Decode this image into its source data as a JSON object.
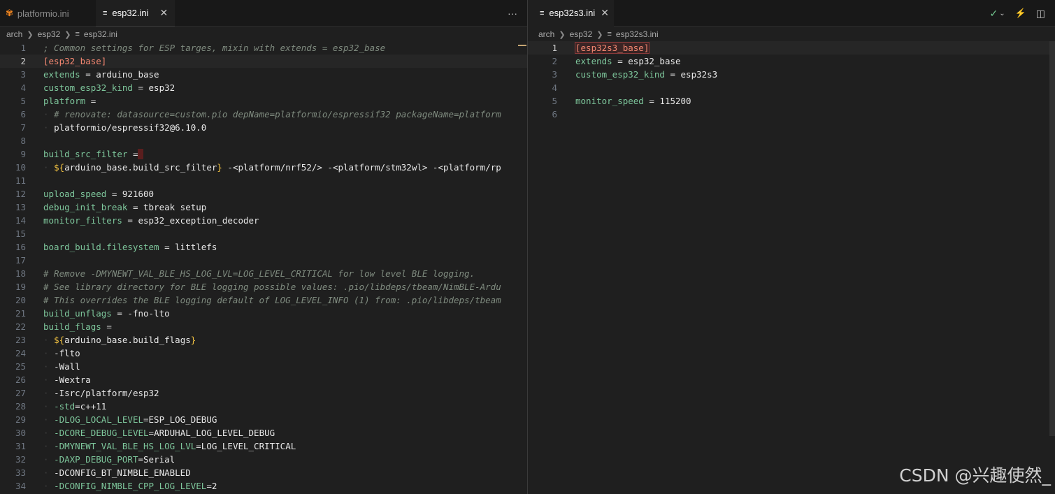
{
  "left_pane": {
    "tabs": [
      {
        "label": "platformio.ini",
        "active": false
      },
      {
        "label": "esp32.ini",
        "active": true
      }
    ],
    "more_actions": "···",
    "breadcrumb": [
      "arch",
      "esp32",
      "esp32.ini"
    ],
    "lines": [
      {
        "n": "1",
        "parts": [
          [
            "cm",
            "; Common settings for ESP targes, mixin with extends = esp32_base"
          ]
        ]
      },
      {
        "n": "2",
        "parts": [
          [
            "sec",
            "[esp32_base]"
          ]
        ],
        "current": true
      },
      {
        "n": "3",
        "parts": [
          [
            "kg",
            "extends"
          ],
          [
            "op",
            " = "
          ],
          [
            "v",
            "arduino_base"
          ]
        ]
      },
      {
        "n": "4",
        "parts": [
          [
            "kg",
            "custom_esp32_kind"
          ],
          [
            "op",
            " = "
          ],
          [
            "v",
            "esp32"
          ]
        ]
      },
      {
        "n": "5",
        "parts": [
          [
            "kg",
            "platform"
          ],
          [
            "op",
            " ="
          ]
        ]
      },
      {
        "n": "6",
        "parts": [
          [
            "dot",
            "  "
          ],
          [
            "cm",
            "# renovate: datasource=custom.pio depName=platformio/espressif32 packageName=platform"
          ]
        ]
      },
      {
        "n": "7",
        "parts": [
          [
            "dot",
            "  "
          ],
          [
            "v",
            "platformio/espressif32@6.10.0"
          ]
        ]
      },
      {
        "n": "8",
        "parts": []
      },
      {
        "n": "9",
        "parts": [
          [
            "kg",
            "build_src_filter"
          ],
          [
            "op",
            " ="
          ],
          [
            "sel",
            " "
          ]
        ]
      },
      {
        "n": "10",
        "parts": [
          [
            "dot",
            "  "
          ],
          [
            "br",
            "${"
          ],
          [
            "v",
            "arduino_base.build_src_filter"
          ],
          [
            "br",
            "}"
          ],
          [
            "v",
            " -<platform/nrf52/> -<platform/stm32wl> -<platform/rp"
          ]
        ]
      },
      {
        "n": "11",
        "parts": []
      },
      {
        "n": "12",
        "parts": [
          [
            "kg",
            "upload_speed"
          ],
          [
            "op",
            " = "
          ],
          [
            "v",
            "921600"
          ]
        ]
      },
      {
        "n": "13",
        "parts": [
          [
            "kg",
            "debug_init_break"
          ],
          [
            "op",
            " = "
          ],
          [
            "v",
            "tbreak setup"
          ]
        ]
      },
      {
        "n": "14",
        "parts": [
          [
            "kg",
            "monitor_filters"
          ],
          [
            "op",
            " = "
          ],
          [
            "v",
            "esp32_exception_decoder"
          ]
        ]
      },
      {
        "n": "15",
        "parts": []
      },
      {
        "n": "16",
        "parts": [
          [
            "kg",
            "board_build.filesystem"
          ],
          [
            "op",
            " = "
          ],
          [
            "v",
            "littlefs"
          ]
        ]
      },
      {
        "n": "17",
        "parts": []
      },
      {
        "n": "18",
        "parts": [
          [
            "cm",
            "# Remove -DMYNEWT_VAL_BLE_HS_LOG_LVL=LOG_LEVEL_CRITICAL for low level BLE logging."
          ]
        ]
      },
      {
        "n": "19",
        "parts": [
          [
            "cm",
            "# See library directory for BLE logging possible values: .pio/libdeps/tbeam/NimBLE-Ardu"
          ]
        ]
      },
      {
        "n": "20",
        "parts": [
          [
            "cm",
            "# This overrides the BLE logging default of LOG_LEVEL_INFO (1) from: .pio/libdeps/tbeam"
          ]
        ]
      },
      {
        "n": "21",
        "parts": [
          [
            "kg",
            "build_unflags"
          ],
          [
            "op",
            " = "
          ],
          [
            "v",
            "-fno-lto"
          ]
        ]
      },
      {
        "n": "22",
        "parts": [
          [
            "kg",
            "build_flags"
          ],
          [
            "op",
            " ="
          ]
        ]
      },
      {
        "n": "23",
        "parts": [
          [
            "dot",
            "  "
          ],
          [
            "br",
            "${"
          ],
          [
            "v",
            "arduino_base.build_flags"
          ],
          [
            "br",
            "}"
          ]
        ]
      },
      {
        "n": "24",
        "parts": [
          [
            "dot",
            "  "
          ],
          [
            "v",
            "-flto"
          ]
        ]
      },
      {
        "n": "25",
        "parts": [
          [
            "dot",
            "  "
          ],
          [
            "v",
            "-Wall"
          ]
        ]
      },
      {
        "n": "26",
        "parts": [
          [
            "dot",
            "  "
          ],
          [
            "v",
            "-Wextra"
          ]
        ]
      },
      {
        "n": "27",
        "parts": [
          [
            "dot",
            "  "
          ],
          [
            "v",
            "-Isrc/platform/esp32"
          ]
        ]
      },
      {
        "n": "28",
        "parts": [
          [
            "dot",
            "  "
          ],
          [
            "kg",
            "-std"
          ],
          [
            "op",
            "="
          ],
          [
            "v",
            "c++11"
          ]
        ]
      },
      {
        "n": "29",
        "parts": [
          [
            "dot",
            "  "
          ],
          [
            "kg",
            "-DLOG_LOCAL_LEVEL"
          ],
          [
            "op",
            "="
          ],
          [
            "v",
            "ESP_LOG_DEBUG"
          ]
        ]
      },
      {
        "n": "30",
        "parts": [
          [
            "dot",
            "  "
          ],
          [
            "kg",
            "-DCORE_DEBUG_LEVEL"
          ],
          [
            "op",
            "="
          ],
          [
            "v",
            "ARDUHAL_LOG_LEVEL_DEBUG"
          ]
        ]
      },
      {
        "n": "31",
        "parts": [
          [
            "dot",
            "  "
          ],
          [
            "kg",
            "-DMYNEWT_VAL_BLE_HS_LOG_LVL"
          ],
          [
            "op",
            "="
          ],
          [
            "v",
            "LOG_LEVEL_CRITICAL"
          ]
        ]
      },
      {
        "n": "32",
        "parts": [
          [
            "dot",
            "  "
          ],
          [
            "kg",
            "-DAXP_DEBUG_PORT"
          ],
          [
            "op",
            "="
          ],
          [
            "v",
            "Serial"
          ]
        ]
      },
      {
        "n": "33",
        "parts": [
          [
            "dot",
            "  "
          ],
          [
            "v",
            "-DCONFIG_BT_NIMBLE_ENABLED"
          ]
        ]
      },
      {
        "n": "34",
        "parts": [
          [
            "dot",
            "  "
          ],
          [
            "kg",
            "-DCONFIG_NIMBLE_CPP_LOG_LEVEL"
          ],
          [
            "op",
            "="
          ],
          [
            "v",
            "2"
          ]
        ]
      }
    ]
  },
  "right_pane": {
    "tabs": [
      {
        "label": "esp32s3.ini",
        "active": true
      }
    ],
    "breadcrumb": [
      "arch",
      "esp32",
      "esp32s3.ini"
    ],
    "lines": [
      {
        "n": "1",
        "parts": [
          [
            "secbox",
            "[esp32s3_base]"
          ]
        ],
        "current": true
      },
      {
        "n": "2",
        "parts": [
          [
            "kg",
            "extends"
          ],
          [
            "op",
            " = "
          ],
          [
            "v",
            "esp32_base"
          ]
        ]
      },
      {
        "n": "3",
        "parts": [
          [
            "kg",
            "custom_esp32_kind"
          ],
          [
            "op",
            " = "
          ],
          [
            "v",
            "esp32s3"
          ]
        ]
      },
      {
        "n": "4",
        "parts": []
      },
      {
        "n": "5",
        "parts": [
          [
            "kg",
            "monitor_speed"
          ],
          [
            "op",
            " = "
          ],
          [
            "v",
            "115200"
          ]
        ]
      },
      {
        "n": "6",
        "parts": []
      }
    ]
  },
  "icons": {
    "check": "check-icon",
    "chevron": "chevron-down-icon",
    "plug": "plug-icon",
    "split": "split-editor-icon",
    "more": "more-actions-icon"
  },
  "watermark": "CSDN @兴趣使然_"
}
